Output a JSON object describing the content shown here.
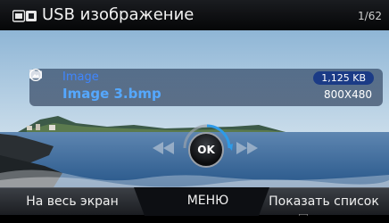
{
  "header": {
    "title": "USB изображение",
    "counter": "1/62",
    "usb_icon": "usb-icon"
  },
  "file_info": {
    "folder_label": "Image",
    "file_name": "Image 3.bmp",
    "file_size": "1,125 KB",
    "resolution": "800X480"
  },
  "controls": {
    "ok_label": "OK",
    "prev_icon": "rewind-icon",
    "next_icon": "fast-forward-icon"
  },
  "menu": {
    "fullscreen_label": "На весь экран",
    "menu_label": "МЕНЮ",
    "show_list_label": "Показать список"
  },
  "colors": {
    "accent": "#55a8ff",
    "badge": "#1b3b86",
    "bar": "#0d0f13"
  }
}
